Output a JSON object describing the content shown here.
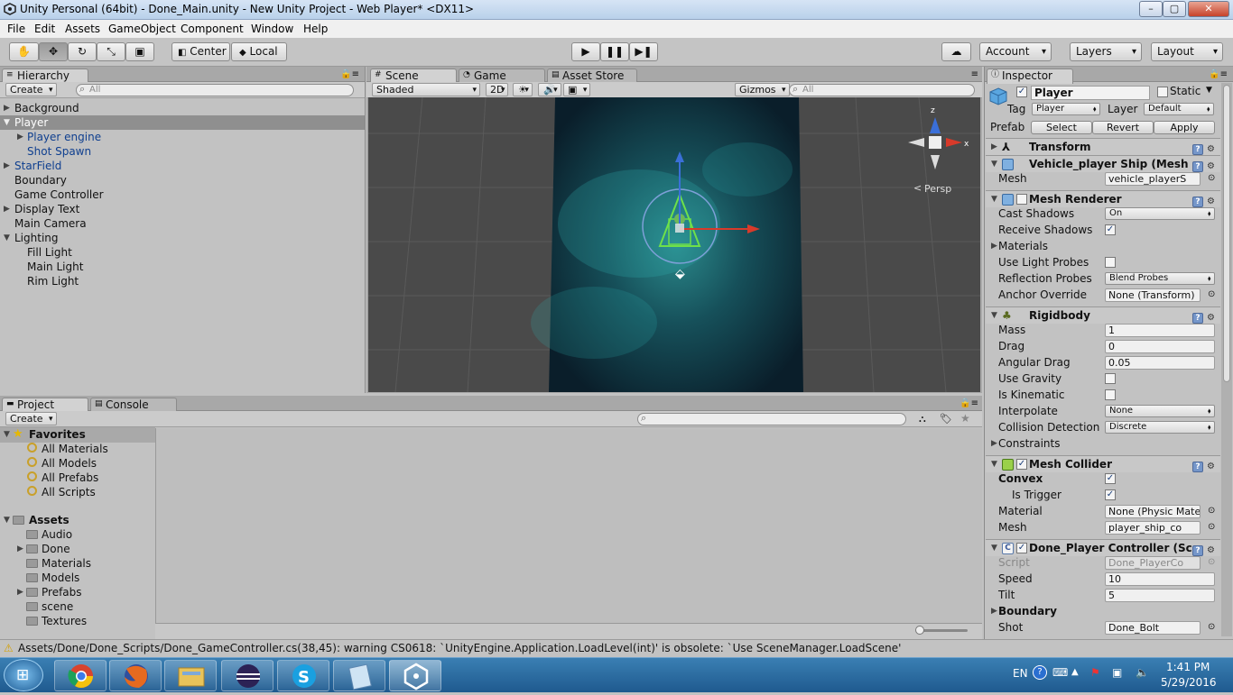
{
  "window": {
    "title": "Unity Personal (64bit) - Done_Main.unity - New Unity Project - Web Player* <DX11>"
  },
  "menu": [
    "File",
    "Edit",
    "Assets",
    "GameObject",
    "Component",
    "Window",
    "Help"
  ],
  "toolbar": {
    "pivot_label": "Center",
    "space_label": "Local",
    "account_label": "Account",
    "layers_label": "Layers",
    "layout_label": "Layout"
  },
  "hierarchy": {
    "tab": "Hierarchy",
    "create_label": "Create",
    "search_placeholder": "All",
    "items": [
      "Background",
      "Player",
      "Player engine",
      "Shot Spawn",
      "StarField",
      "Boundary",
      "Game Controller",
      "Display Text",
      "Main Camera",
      "Lighting",
      "Fill Light",
      "Main Light",
      "Rim Light"
    ]
  },
  "scene": {
    "tabs": [
      "Scene",
      "Game",
      "Asset Store"
    ],
    "shading": "Shaded",
    "mode_2d": "2D",
    "gizmos_label": "Gizmos",
    "search_placeholder": "All",
    "persp_label": "Persp",
    "axis_y": "y",
    "axis_z": "z",
    "axis_x": "x"
  },
  "project": {
    "tabs": [
      "Project",
      "Console"
    ],
    "create_label": "Create",
    "favorites_label": "Favorites",
    "favorites": [
      "All Materials",
      "All Models",
      "All Prefabs",
      "All Scripts"
    ],
    "assets_label": "Assets",
    "assets": [
      "Audio",
      "Done",
      "Materials",
      "Models",
      "Prefabs",
      "scene",
      "Textures"
    ]
  },
  "inspector": {
    "tab": "Inspector",
    "object_name": "Player",
    "static_label": "Static",
    "tag_label": "Tag",
    "tag_value": "Player",
    "layer_label": "Layer",
    "layer_value": "Default",
    "prefab_label": "Prefab",
    "prefab_select": "Select",
    "prefab_revert": "Revert",
    "prefab_apply": "Apply",
    "transform": "Transform",
    "meshfilter": "Vehicle_player Ship (Mesh",
    "meshfilter_mesh_label": "Mesh",
    "meshfilter_mesh_value": "vehicle_playerS",
    "meshrenderer": "Mesh Renderer",
    "cast_shadows_label": "Cast Shadows",
    "cast_shadows_value": "On",
    "receive_shadows_label": "Receive Shadows",
    "materials_label": "Materials",
    "light_probes_label": "Use Light Probes",
    "reflection_probes_label": "Reflection Probes",
    "reflection_probes_value": "Blend Probes",
    "anchor_override_label": "Anchor Override",
    "anchor_override_value": "None (Transform)",
    "rigidbody": "Rigidbody",
    "mass_label": "Mass",
    "mass_value": "1",
    "drag_label": "Drag",
    "drag_value": "0",
    "angular_drag_label": "Angular Drag",
    "angular_drag_value": "0.05",
    "use_gravity_label": "Use Gravity",
    "is_kinematic_label": "Is Kinematic",
    "interpolate_label": "Interpolate",
    "interpolate_value": "None",
    "collision_label": "Collision Detection",
    "collision_value": "Discrete",
    "constraints_label": "Constraints",
    "meshcollider": "Mesh Collider",
    "convex_label": "Convex",
    "is_trigger_label": "Is Trigger",
    "material_label": "Material",
    "material_value": "None (Physic Mate",
    "mc_mesh_label": "Mesh",
    "mc_mesh_value": "player_ship_co",
    "controller": "Done_Player Controller (Sc",
    "script_label": "Script",
    "script_value": "Done_PlayerCo",
    "speed_label": "Speed",
    "speed_value": "10",
    "tilt_label": "Tilt",
    "tilt_value": "5",
    "boundary_label": "Boundary",
    "shot_label": "Shot",
    "shot_value": "Done_Bolt"
  },
  "status": {
    "message": "Assets/Done/Done_Scripts/Done_GameController.cs(38,45): warning CS0618: `UnityEngine.Application.LoadLevel(int)' is obsolete: `Use SceneManager.LoadScene'"
  },
  "taskbar": {
    "lang": "EN",
    "time": "1:41 PM",
    "date": "5/29/2016"
  }
}
